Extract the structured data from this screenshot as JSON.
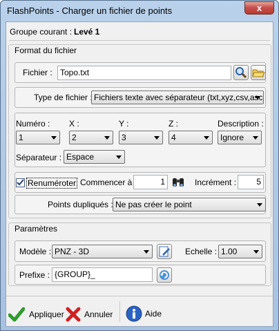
{
  "window": {
    "title": "FlashPoints - Charger un fichier de points",
    "close_glyph": "x"
  },
  "group": {
    "label": "Groupe courant :",
    "value": "Levé 1"
  },
  "format": {
    "title": "Format du fichier",
    "file_label": "Fichier :",
    "file_value": "Topo.txt",
    "type_label": "Type de fichier :",
    "type_value": "Fichiers texte avec séparateur (txt,xyz,csv,asc)",
    "columns": [
      {
        "label": "Numéro :",
        "value": "1"
      },
      {
        "label": "X :",
        "value": "2"
      },
      {
        "label": "Y :",
        "value": "3"
      },
      {
        "label": "Z :",
        "value": "4"
      },
      {
        "label": "Description :",
        "value": "Ignore"
      }
    ],
    "separator_label": "Séparateur :",
    "separator_value": "Espace",
    "renumber_label": "Renuméroter",
    "renumber_checked": true,
    "start_label": "Commencer à :",
    "start_value": "1",
    "increment_label": "Incrément :",
    "increment_value": "5",
    "duplicates_label": "Points dupliqués :",
    "duplicates_value": "Ne pas créer le point"
  },
  "params": {
    "title": "Paramètres",
    "model_label": "Modèle :",
    "model_value": "PNZ - 3D",
    "scale_label": "Echelle :",
    "scale_value": "1.00",
    "prefix_label": "Prefixe :",
    "prefix_value": "{GROUP}_"
  },
  "footer": {
    "apply": "Appliquer",
    "cancel": "Annuler",
    "help": "Aide"
  },
  "colors": {
    "title_bar": "#b9d1ea",
    "apply_green": "#2e9b2e",
    "cancel_red": "#d02020",
    "help_blue": "#2a63c4"
  }
}
